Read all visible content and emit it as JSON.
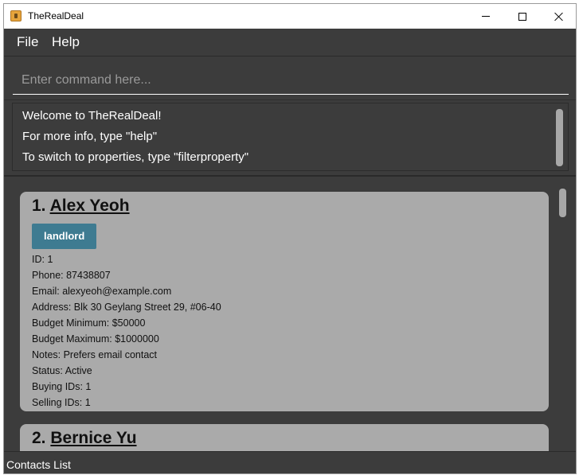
{
  "window": {
    "title": "TheRealDeal"
  },
  "menu": {
    "file": "File",
    "help": "Help"
  },
  "command": {
    "placeholder": "Enter command here..."
  },
  "result": {
    "lines": [
      "Welcome to TheRealDeal!",
      "For more info, type \"help\"",
      "To switch to properties, type \"filterproperty\""
    ]
  },
  "persons": [
    {
      "index": "1.",
      "name": "Alex Yeoh",
      "tag": "landlord",
      "details": [
        "ID: 1",
        "Phone: 87438807",
        "Email: alexyeoh@example.com",
        "Address: Blk 30 Geylang Street 29, #06-40",
        "Budget Minimum: $50000",
        "Budget Maximum: $1000000",
        "Notes: Prefers email contact",
        "Status: Active",
        "Buying IDs: 1",
        "Selling IDs: 1"
      ]
    },
    {
      "index": "2.",
      "name": "Bernice Yu"
    }
  ],
  "status": {
    "text": "Contacts List"
  },
  "icons": {
    "app": "app-logo-icon",
    "minimize": "minimize-icon",
    "maximize": "maximize-icon",
    "close": "close-icon"
  }
}
